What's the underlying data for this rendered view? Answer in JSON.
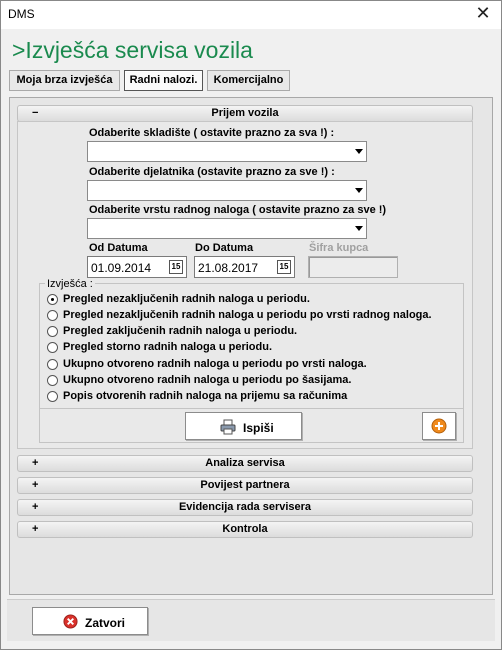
{
  "window": {
    "title": "DMS",
    "close_glyph": "✕"
  },
  "page_title": ">Izvješća servisa vozila",
  "tabs": [
    {
      "label": "Moja brza izvješća"
    },
    {
      "label": "Radni nalozi.",
      "active": true
    },
    {
      "label": "Komercijalno"
    }
  ],
  "prijem": {
    "header": "Prijem vozila",
    "sign": "−",
    "skladiste_label": "Odaberite skladište ( ostavite prazno za sva !) :",
    "djelatnik_label": "Odaberite djelatnika (ostavite prazno za sve !) :",
    "vrsta_label": "Odaberite vrstu radnog naloga ( ostavite prazno za sve !)",
    "od_datuma_label": "Od Datuma",
    "od_datuma_value": "01.09.2014",
    "do_datuma_label": "Do Datuma",
    "do_datuma_value": "21.08.2017",
    "sifra_label": "Šifra kupca",
    "calendar_glyph": "15",
    "reports_legend": "Izvješća :",
    "reports": [
      "Pregled nezaključenih radnih naloga u periodu.",
      "Pregled nezaključenih radnih naloga u periodu po vrsti radnog naloga.",
      "Pregled zaključenih radnih naloga u periodu.",
      "Pregled storno radnih naloga u periodu.",
      "Ukupno otvoreno radnih naloga u periodu po vrsti naloga.",
      "Ukupno otvoreno radnih naloga u periodu po šasijama.",
      "Popis otvorenih radnih naloga na prijemu sa računima"
    ],
    "selected_report_index": 0,
    "print_button": "Ispiši"
  },
  "sections": [
    {
      "sign": "+",
      "label": "Analiza servisa"
    },
    {
      "sign": "+",
      "label": "Povijest partnera"
    },
    {
      "sign": "+",
      "label": "Evidencija rada servisera"
    },
    {
      "sign": "+",
      "label": "Kontrola"
    }
  ],
  "close_button": "Zatvori",
  "colors": {
    "title_green": "#1a8a4e",
    "close_red": "#d9312b",
    "add_orange": "#f08a1c"
  }
}
